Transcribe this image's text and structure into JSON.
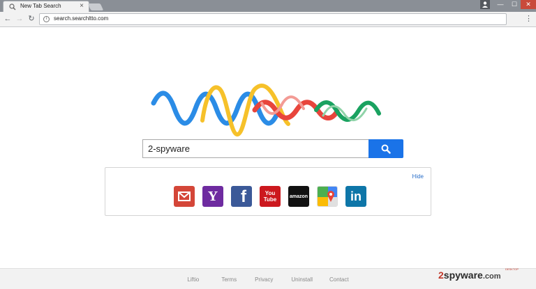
{
  "browser": {
    "tab_title": "New Tab Search",
    "tab_close": "×",
    "url": "search.searchltto.com",
    "window_min": "—",
    "window_max": "☐",
    "window_close": "✕"
  },
  "search": {
    "query": "2-spyware"
  },
  "shortcuts": {
    "hide_label": "Hide",
    "sites": [
      {
        "name": "gmail",
        "color": "#d44638"
      },
      {
        "name": "yahoo",
        "color": "#6e2ba0",
        "label": "Y"
      },
      {
        "name": "facebook",
        "color": "#3b5998",
        "label": "f"
      },
      {
        "name": "youtube",
        "color": "#cc181e",
        "label": "You\nTube"
      },
      {
        "name": "amazon",
        "color": "#111111",
        "label": "amazon"
      },
      {
        "name": "google-maps",
        "color": "#4caf50"
      },
      {
        "name": "linkedin",
        "color": "#0e76a8",
        "label": "in"
      }
    ]
  },
  "footer": {
    "links": [
      "Liftio",
      "Terms",
      "Privacy",
      "Uninstall",
      "Contact"
    ]
  },
  "watermark": {
    "prefix": "2",
    "brand": "spyware",
    "domain": ".com",
    "tag": "DESKTOP"
  },
  "colors": {
    "blue_wave": "#2b8ce6",
    "yellow_wave": "#f6c12a",
    "red_wave": "#e8453c",
    "green_wave": "#1aa260",
    "search_button": "#1a73e8"
  }
}
